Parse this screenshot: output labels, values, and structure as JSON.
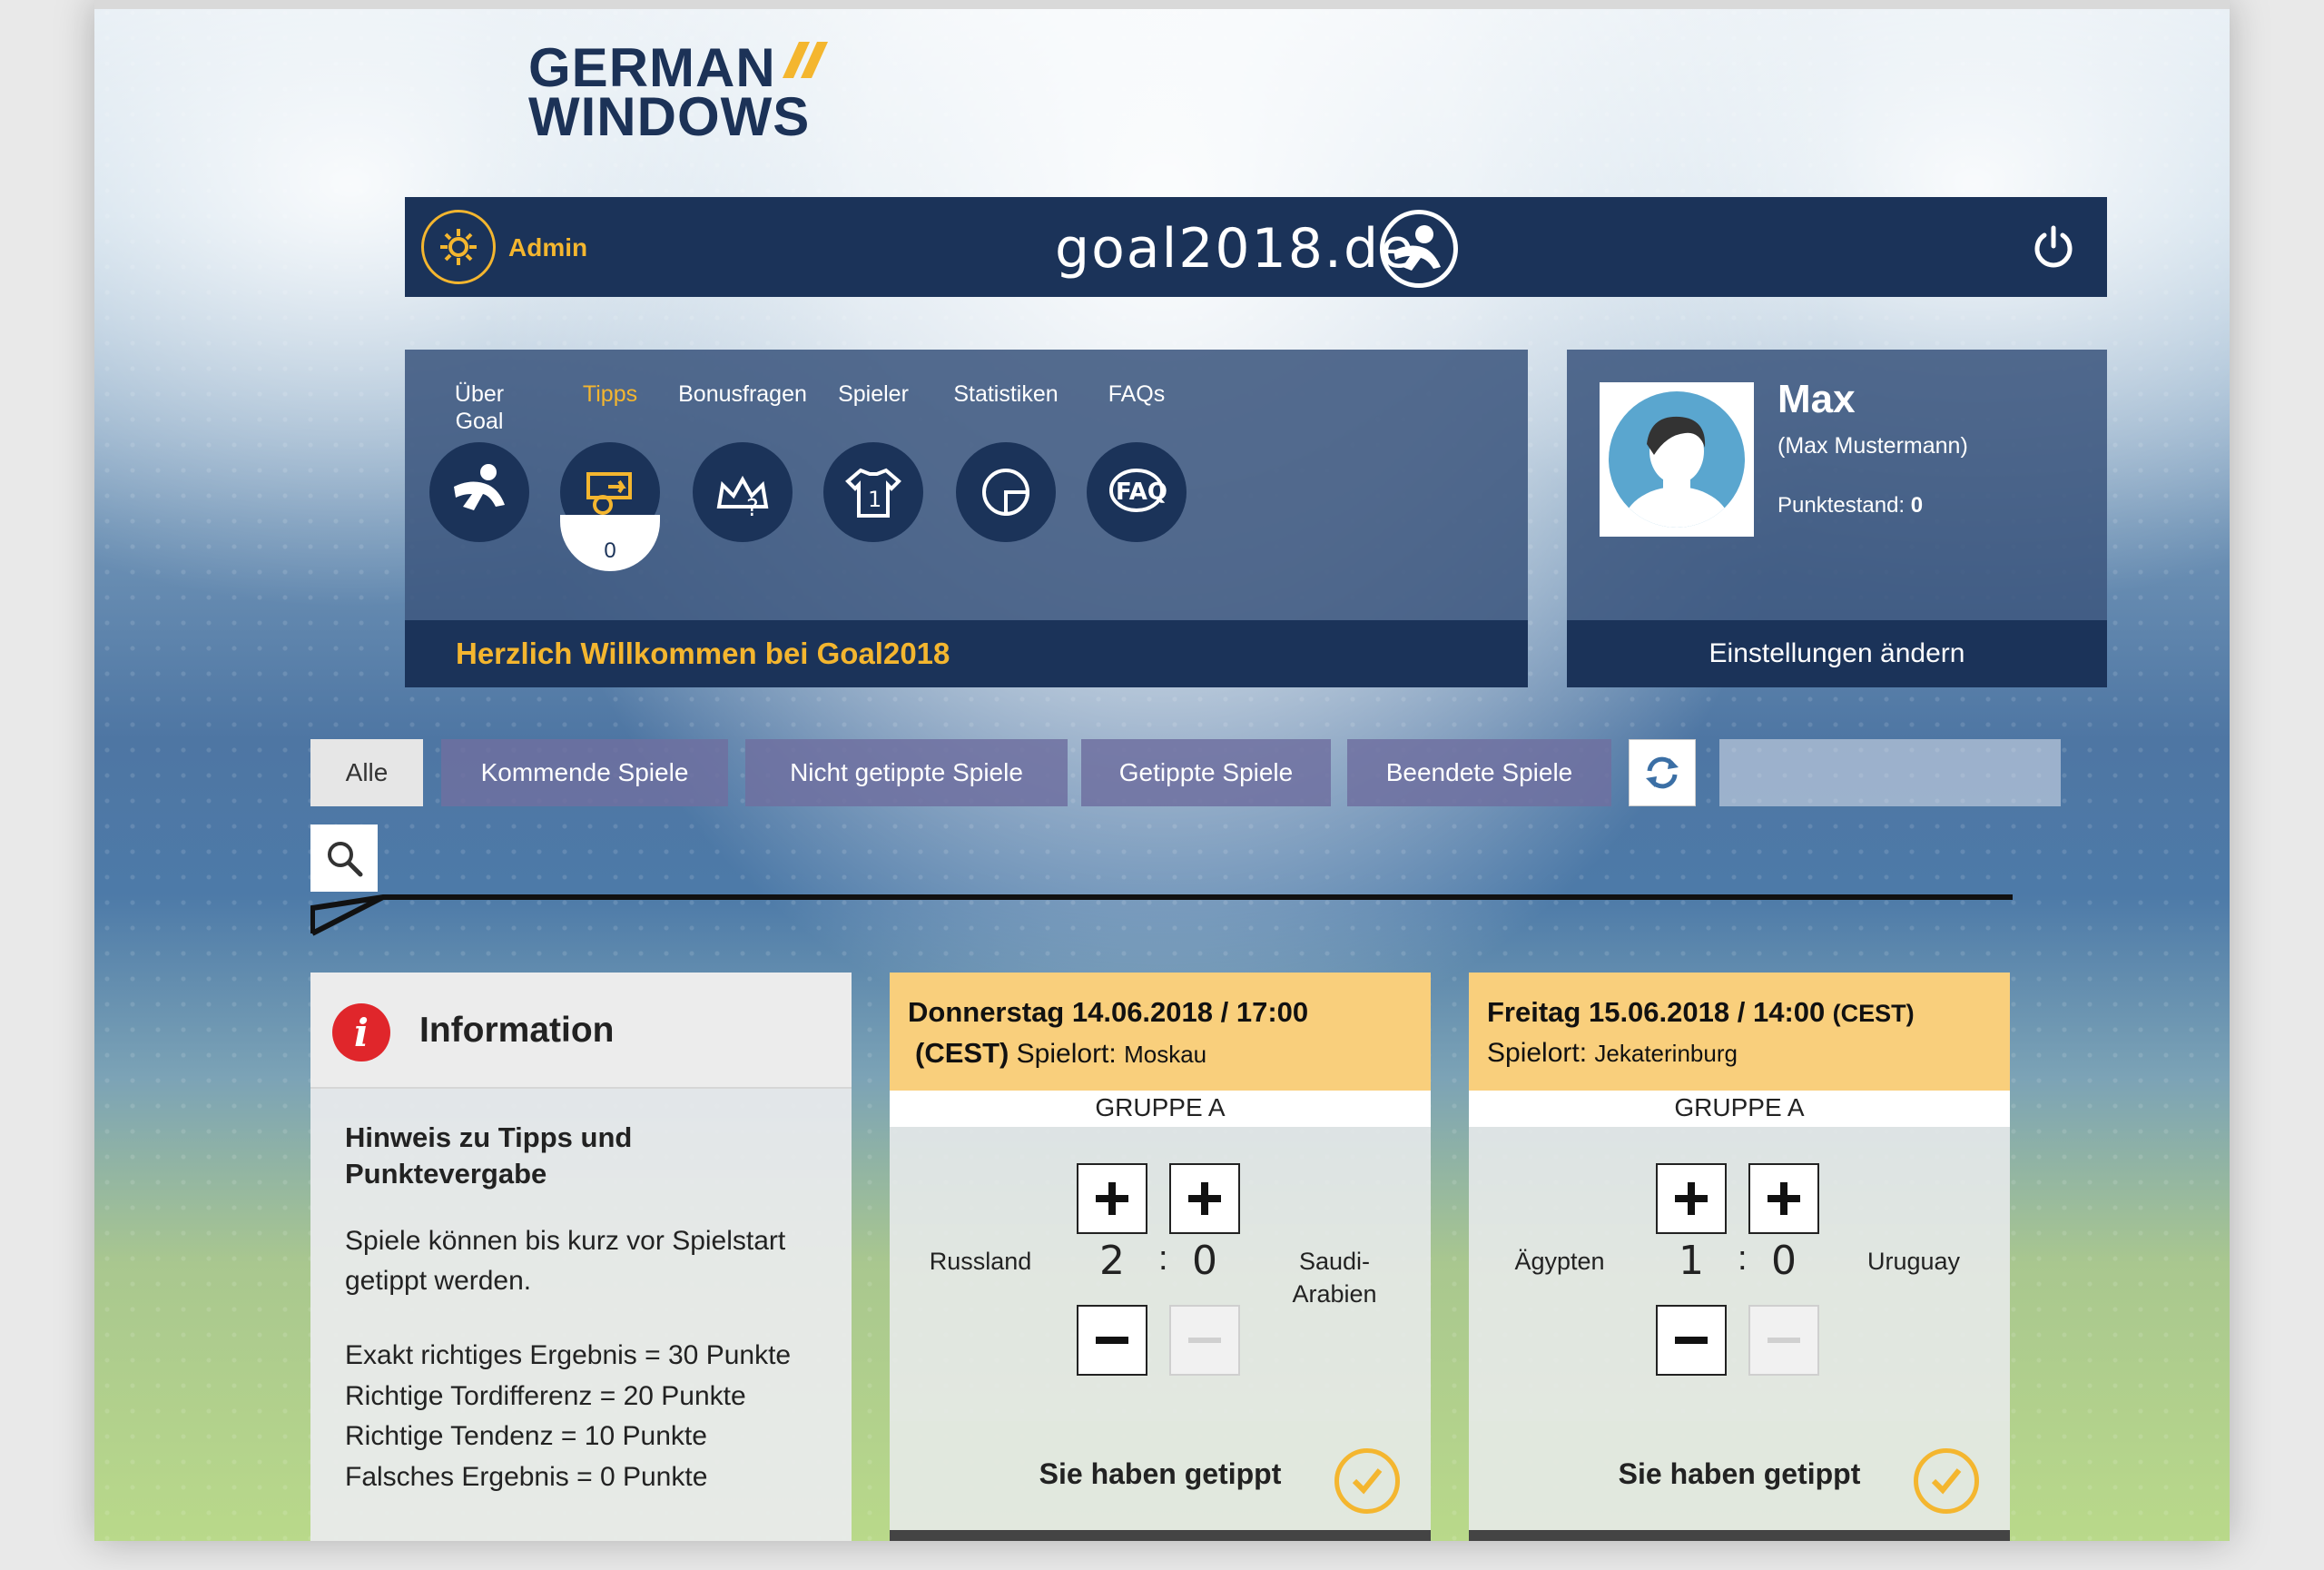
{
  "logo": {
    "line1": "GERMAN",
    "line2": "WINDOWS"
  },
  "header": {
    "admin_label": "Admin",
    "site_title": "goal2018.de"
  },
  "nav": {
    "items": [
      {
        "label": "Über Goal",
        "icon": "player-kick-icon",
        "active": false
      },
      {
        "label": "Tipps",
        "icon": "tipps-icon",
        "active": true,
        "badge": "0"
      },
      {
        "label": "Bonusfragen",
        "icon": "crown-question-icon",
        "active": false
      },
      {
        "label": "Spieler",
        "icon": "jersey-icon",
        "active": false
      },
      {
        "label": "Statistiken",
        "icon": "pie-chart-icon",
        "active": false
      },
      {
        "label": "FAQs",
        "icon": "faq-icon",
        "active": false
      }
    ],
    "welcome": "Herzlich Willkommen bei Goal2018"
  },
  "profile": {
    "name": "Max",
    "full_name": "(Max Mustermann)",
    "score_label": "Punktestand:",
    "score_value": "0",
    "settings_label": "Einstellungen ändern"
  },
  "filters": {
    "all": "Alle",
    "upcoming": "Kommende Spiele",
    "not_tipped": "Nicht getippte Spiele",
    "tipped": "Getippte Spiele",
    "finished": "Beendete Spiele"
  },
  "info": {
    "title": "Information",
    "subtitle": "Hinweis zu Tipps und Punktevergabe",
    "text": "Spiele können bis kurz vor Spielstart getippt werden.",
    "rules": [
      "Exakt richtiges Ergebnis = 30 Punkte",
      "Richtige Tordifferenz = 20 Punkte",
      "Richtige Tendenz = 10 Punkte",
      "Falsches Ergebnis = 0 Punkte"
    ]
  },
  "matches": [
    {
      "date": "Donnerstag 14.06.2018 / 17:00",
      "tz": "(CEST)",
      "venue_label": "Spielort:",
      "venue": "Moskau",
      "group": "GRUPPE A",
      "home": "Russland",
      "away": "Saudi-Arabien",
      "home_score": "2",
      "away_score": "0",
      "tipped_label": "Sie haben getippt"
    },
    {
      "date": "Freitag 15.06.2018 / 14:00",
      "tz": "(CEST)",
      "venue_label": "Spielort:",
      "venue": "Jekaterinburg",
      "group": "GRUPPE A",
      "home": "Ägypten",
      "away": "Uruguay",
      "home_score": "1",
      "away_score": "0",
      "tipped_label": "Sie haben getippt"
    }
  ],
  "colors": {
    "navy": "#1b3359",
    "accent_yellow": "#f4b62f",
    "match_header": "#f9cf7c",
    "info_red": "#e0262b"
  }
}
